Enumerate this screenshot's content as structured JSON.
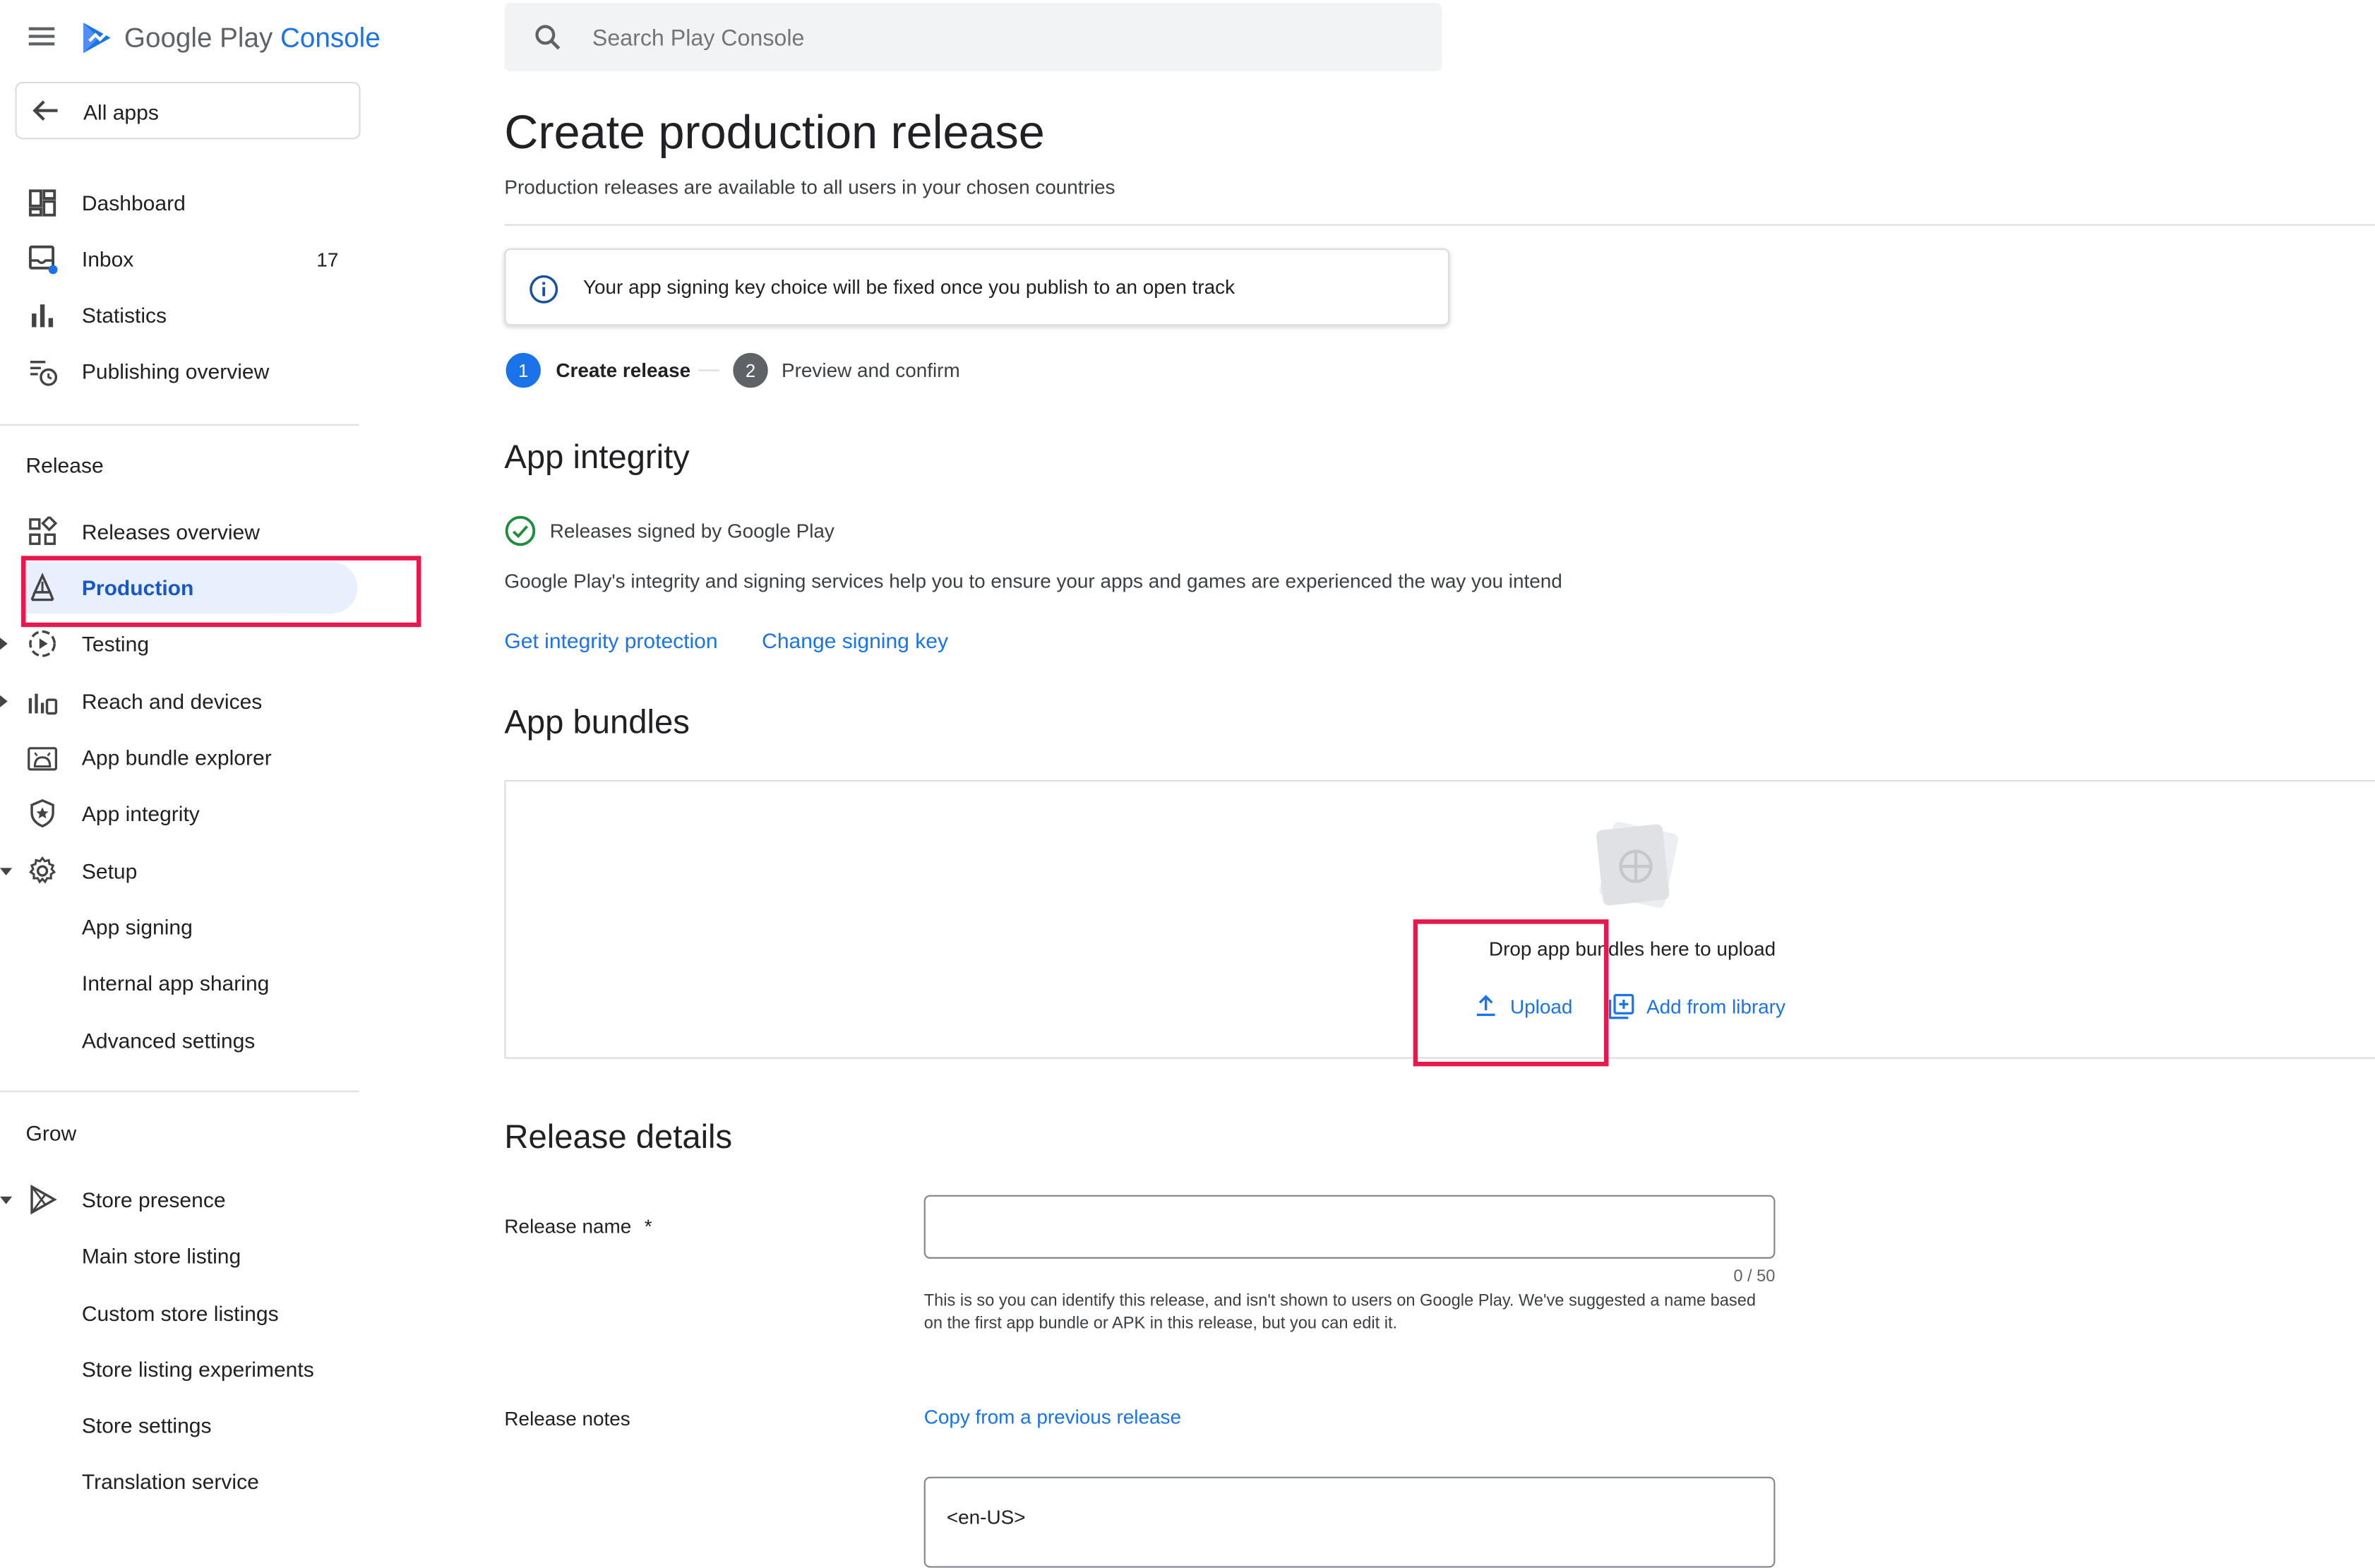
{
  "header": {
    "logo_google_play": "Google Play",
    "logo_console": "Console",
    "search_placeholder": "Search Play Console"
  },
  "sidebar": {
    "all_apps": "All apps",
    "top_items": [
      {
        "label": "Dashboard",
        "icon": "dashboard-icon"
      },
      {
        "label": "Inbox",
        "icon": "inbox-icon",
        "badge": "17"
      },
      {
        "label": "Statistics",
        "icon": "bar-chart-icon"
      },
      {
        "label": "Publishing overview",
        "icon": "publishing-icon"
      }
    ],
    "release_heading": "Release",
    "release_items": [
      {
        "label": "Releases overview",
        "icon": "releases-grid-icon"
      },
      {
        "label": "Production",
        "icon": "production-icon",
        "active": true
      },
      {
        "label": "Testing",
        "icon": "testing-icon"
      },
      {
        "label": "Reach and devices",
        "icon": "reach-icon"
      },
      {
        "label": "App bundle explorer",
        "icon": "android-icon"
      },
      {
        "label": "App integrity",
        "icon": "shield-icon"
      },
      {
        "label": "Setup",
        "icon": "gear-icon"
      },
      {
        "label": "App signing"
      },
      {
        "label": "Internal app sharing"
      },
      {
        "label": "Advanced settings"
      }
    ],
    "grow_heading": "Grow",
    "grow_items": [
      {
        "label": "Store presence",
        "icon": "store-play-icon"
      },
      {
        "label": "Main store listing"
      },
      {
        "label": "Custom store listings"
      },
      {
        "label": "Store listing experiments"
      },
      {
        "label": "Store settings"
      },
      {
        "label": "Translation service"
      }
    ]
  },
  "main": {
    "title": "Create production release",
    "subtitle": "Production releases are available to all users in your chosen countries",
    "info_banner": "Your app signing key choice will be fixed once you publish to an open track",
    "steps": [
      {
        "number": "1",
        "label": "Create release"
      },
      {
        "number": "2",
        "label": "Preview and confirm"
      }
    ],
    "integrity": {
      "heading": "App integrity",
      "status": "Releases signed by Google Play",
      "description": "Google Play's integrity and signing services help you to ensure your apps and games are experienced the way you intend",
      "link_protection": "Get integrity protection",
      "link_change_key": "Change signing key"
    },
    "bundles": {
      "heading": "App bundles",
      "drop_text": "Drop app bundles here to upload",
      "upload_label": "Upload",
      "add_library_label": "Add from library"
    },
    "release_details": {
      "heading": "Release details",
      "name_label": "Release name",
      "required_mark": "*",
      "name_value": "",
      "char_count": "0 / 50",
      "name_help": "This is so you can identify this release, and isn't shown to users on Google Play. We've suggested a name based on the first app bundle or APK in this release, but you can edit it.",
      "notes_label": "Release notes",
      "copy_link": "Copy from a previous release",
      "notes_value": "<en-US>"
    }
  },
  "colors": {
    "accent": "#1a73e8",
    "highlight": "#e8174c",
    "active_bg": "#e8f0fe",
    "success": "#1e8e3e"
  }
}
